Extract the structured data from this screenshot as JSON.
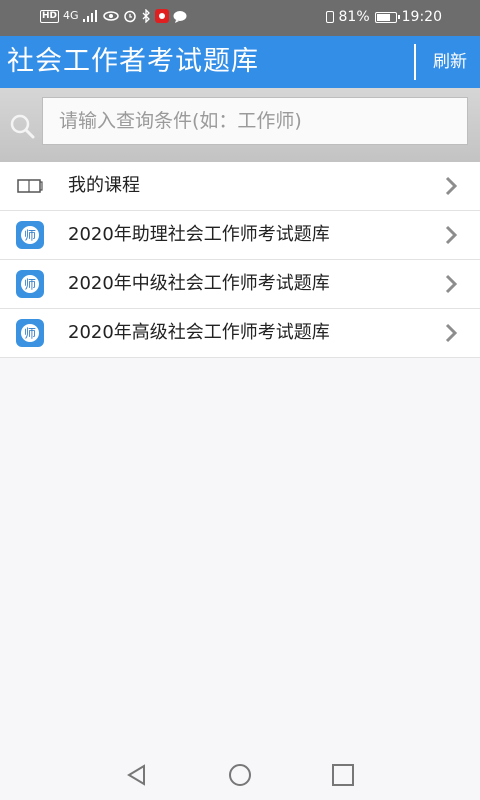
{
  "status_bar": {
    "left_hd": "HD",
    "left_network": "4G",
    "battery_percent": "81%",
    "battery_level": 0.81,
    "time": "19:20"
  },
  "header": {
    "title": "社会工作者考试题库",
    "refresh_label": "刷新"
  },
  "search": {
    "placeholder": "请输入查询条件(如：工作师)"
  },
  "list": {
    "items": [
      {
        "label": "我的课程",
        "icon": "book-icon"
      },
      {
        "label": "2020年助理社会工作师考试题库",
        "icon": "teacher-app-icon",
        "icon_text": "师"
      },
      {
        "label": "2020年中级社会工作师考试题库",
        "icon": "teacher-app-icon",
        "icon_text": "师"
      },
      {
        "label": "2020年高级社会工作师考试题库",
        "icon": "teacher-app-icon",
        "icon_text": "师"
      }
    ]
  },
  "colors": {
    "accent": "#338ee8",
    "status_bar": "#6d6d6d",
    "background": "#f7f6f9"
  }
}
